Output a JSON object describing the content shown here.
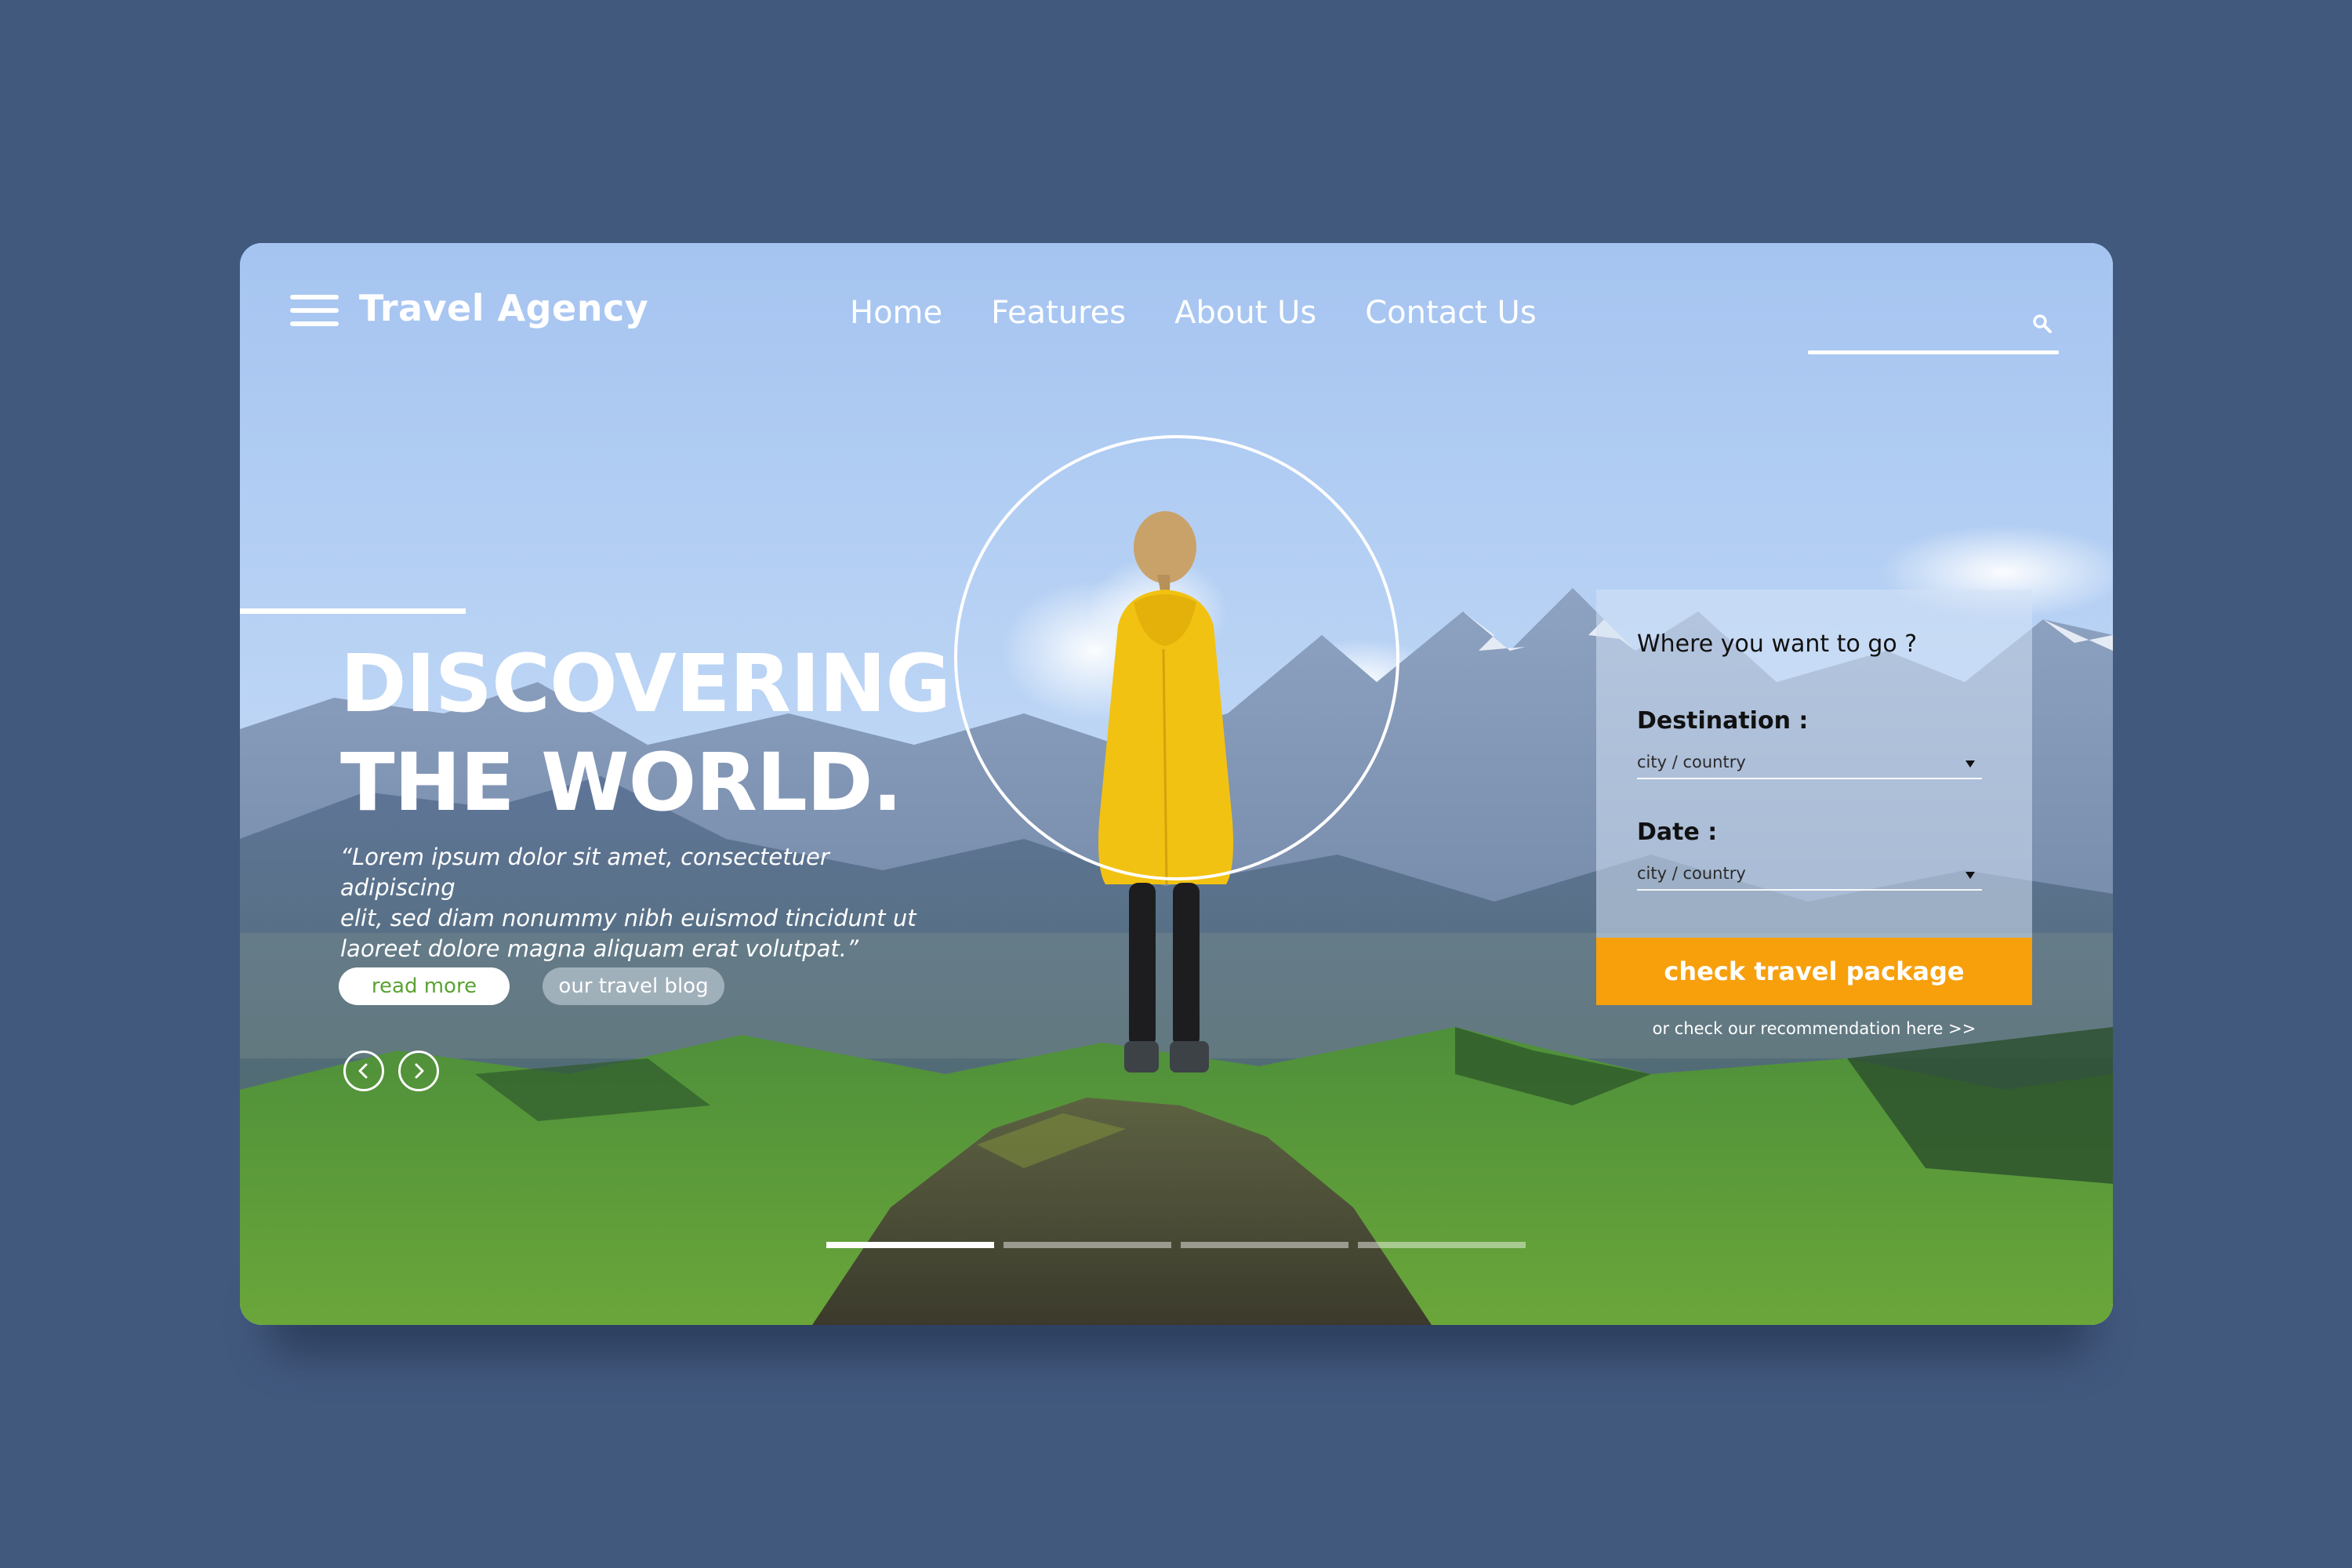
{
  "header": {
    "brand": "Travel Agency",
    "nav": [
      "Home",
      "Features",
      "About Us",
      "Contact Us"
    ],
    "search": {
      "value": ""
    }
  },
  "hero": {
    "headline_line1": "DISCOVERING",
    "headline_line2": "THE WORLD.",
    "quote_line1": "“Lorem ipsum dolor sit amet, consectetuer adipiscing",
    "quote_line2": "elit, sed diam nonummy nibh euismod tincidunt ut",
    "quote_line3": "laoreet dolore magna aliquam erat volutpat.”",
    "read_more": "read more",
    "travel_blog": "our travel blog",
    "slides_total": 4,
    "slide_active": 1
  },
  "booking": {
    "title": "Where you want to go ?",
    "destination_label": "Destination :",
    "destination_value": "city / country",
    "date_label": "Date :",
    "date_value": "city / country",
    "cta": "check travel package",
    "recommendation_link": "or check our recommendation here >>"
  },
  "colors": {
    "page_background": "#42597e",
    "accent": "#f7a00c",
    "read_more_text": "#5ba234",
    "jacket": "#f2c212"
  },
  "icons": [
    "hamburger-menu-icon",
    "search-icon",
    "arrow-left-icon",
    "arrow-right-icon",
    "caret-down-icon"
  ]
}
